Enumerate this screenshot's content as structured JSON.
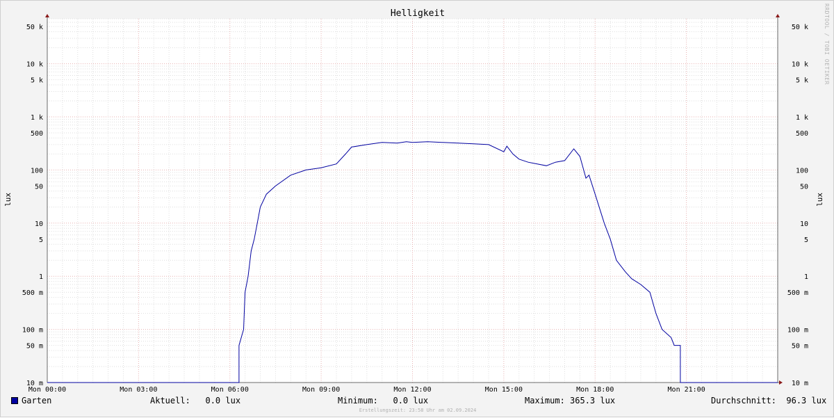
{
  "title": "Helligkeit",
  "side_note": "RRDTOOL / TOBI OETIKER",
  "ylabel": "lux",
  "legend": {
    "series_name": "Garten",
    "series_color": "#0000a0",
    "aktuell": "Aktuell:   0.0 lux",
    "minimum": "Minimum:   0.0 lux",
    "maximum": "Maximum: 365.3 lux",
    "durchschnitt": "Durchschnitt:  96.3 lux"
  },
  "footer": "Erstellungszeit: 23:58 Uhr am 02.09.2024",
  "chart_data": {
    "type": "line",
    "title": "Helligkeit",
    "xlabel": "",
    "ylabel": "lux",
    "y_scale": "log",
    "ylim": [
      0.01,
      70000
    ],
    "xlim_hours": [
      0,
      24
    ],
    "x_ticks": [
      "Mon 00:00",
      "Mon 03:00",
      "Mon 06:00",
      "Mon 09:00",
      "Mon 12:00",
      "Mon 15:00",
      "Mon 18:00",
      "Mon 21:00"
    ],
    "y_ticks": [
      "10 m",
      "50 m",
      "100 m",
      "500 m",
      "1",
      "5",
      "10",
      "50",
      "100",
      "500",
      "1 k",
      "5 k",
      "10 k",
      "50 k"
    ],
    "grid": true,
    "legend_position": "bottom",
    "series": [
      {
        "name": "Garten",
        "color": "#0000a0",
        "x": [
          0,
          6.3,
          6.3,
          6.45,
          6.5,
          6.6,
          6.7,
          6.8,
          6.9,
          7.0,
          7.2,
          7.5,
          8.0,
          8.5,
          9.0,
          9.5,
          9.8,
          10.0,
          10.5,
          11.0,
          11.5,
          11.8,
          12.0,
          12.5,
          13.0,
          13.5,
          14.0,
          14.5,
          15.0,
          15.1,
          15.3,
          15.5,
          15.8,
          16.1,
          16.4,
          16.7,
          17.0,
          17.3,
          17.5,
          17.7,
          17.8,
          18.0,
          18.3,
          18.5,
          18.7,
          19.0,
          19.2,
          19.5,
          19.8,
          20.0,
          20.2,
          20.5,
          20.6,
          20.8,
          20.8,
          24
        ],
        "y": [
          0.01,
          0.01,
          0.05,
          0.1,
          0.5,
          1,
          3,
          5,
          10,
          20,
          35,
          50,
          80,
          100,
          110,
          130,
          200,
          270,
          300,
          330,
          320,
          340,
          330,
          340,
          330,
          320,
          310,
          300,
          220,
          280,
          200,
          160,
          140,
          130,
          120,
          140,
          150,
          250,
          180,
          70,
          80,
          35,
          10,
          5,
          2,
          1.2,
          0.9,
          0.7,
          0.5,
          0.2,
          0.1,
          0.07,
          0.05,
          0.05,
          0.01,
          0.01
        ]
      }
    ]
  }
}
